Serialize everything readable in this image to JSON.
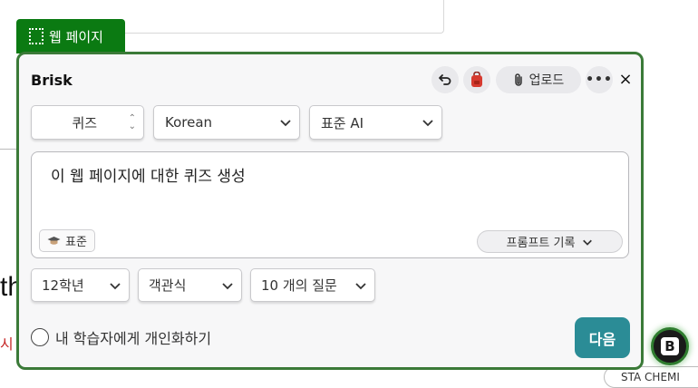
{
  "background": {
    "text_fragment_1": "th",
    "text_fragment_2": "시",
    "bottom_tab": "STA CHEMI"
  },
  "tag": {
    "label": "웹 페이지",
    "icon": "dotted-frame-icon"
  },
  "panel": {
    "brand": "Brisk",
    "header": {
      "undo_icon": "undo-icon",
      "bag_icon": "backpack-icon",
      "upload_label": "업로드",
      "more_label": "•••",
      "close_label": "×"
    },
    "selects": {
      "mode": "퀴즈",
      "language": "Korean",
      "model": "표준 AI"
    },
    "prompt": {
      "text": "이 웹 페이지에 대한 퀴즈 생성",
      "standard_badge": "표준",
      "history_label": "프롬프트 기록"
    },
    "options": {
      "grade": "12학년",
      "question_type": "객관식",
      "question_count": "10 개의 질문"
    },
    "personalize_label": "내 학습자에게 개인화하기",
    "next_label": "다음"
  },
  "colors": {
    "tag_bg": "#0b7a12",
    "panel_border": "#3b7a38",
    "next_bg": "#2b8c96"
  }
}
